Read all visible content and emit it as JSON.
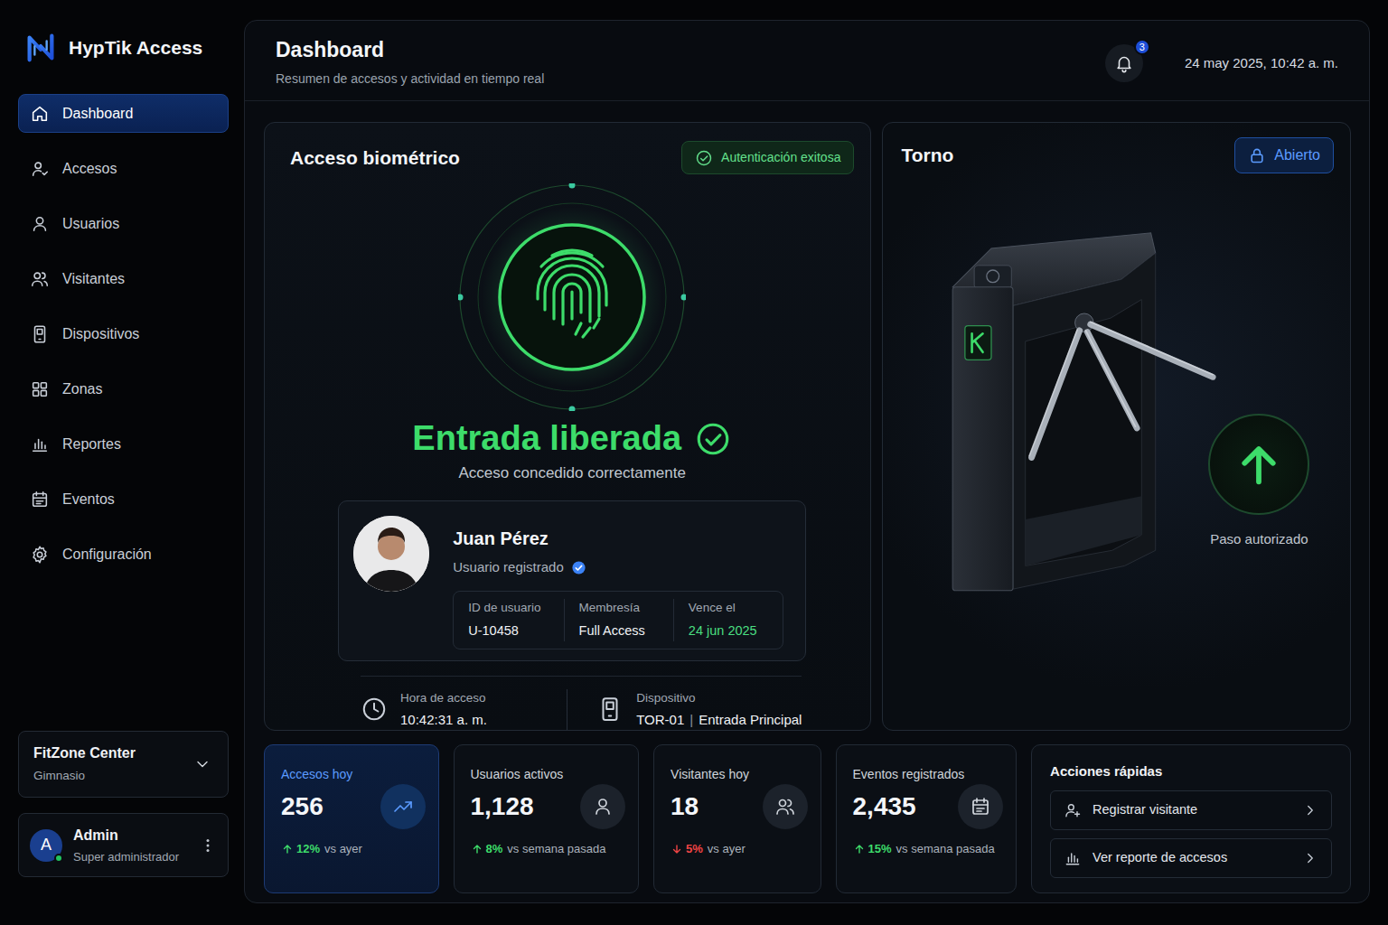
{
  "app": {
    "name": "HypTik Access"
  },
  "sidebar": {
    "items": [
      {
        "label": "Dashboard",
        "selected": true
      },
      {
        "label": "Accesos",
        "selected": false
      },
      {
        "label": "Usuarios",
        "selected": false
      },
      {
        "label": "Visitantes",
        "selected": false
      },
      {
        "label": "Dispositivos",
        "selected": false
      },
      {
        "label": "Zonas",
        "selected": false
      },
      {
        "label": "Reportes",
        "selected": false
      },
      {
        "label": "Eventos",
        "selected": false
      },
      {
        "label": "Configuración",
        "selected": false
      }
    ]
  },
  "org": {
    "name": "FitZone Center",
    "type": "Gimnasio"
  },
  "user": {
    "initial": "A",
    "name": "Admin",
    "role": "Super administrador",
    "online": true
  },
  "header": {
    "title": "Dashboard",
    "subtitle": "Resumen de accesos y actividad en tiempo real",
    "notifications": "3",
    "datetime": "24 may 2025, 10:42 a. m."
  },
  "biometric": {
    "title": "Acceso biométrico",
    "badge": "Autenticación exitosa",
    "status": "Entrada liberada",
    "message": "Acceso concedido correctamente",
    "person": {
      "name": "Juan Pérez",
      "role": "Usuario registrado",
      "verified": true,
      "fields": [
        {
          "label": "ID de usuario",
          "value": "U-10458",
          "highlight": false
        },
        {
          "label": "Membresía",
          "value": "Full Access",
          "highlight": false
        },
        {
          "label": "Vence el",
          "value": "24 jun 2025",
          "highlight": true
        }
      ]
    },
    "access_time": {
      "label": "Hora de acceso",
      "value": "10:42:31 a. m."
    },
    "device": {
      "label": "Dispositivo",
      "id": "TOR-01",
      "separator": "|",
      "location": "Entrada Principal"
    }
  },
  "turnstile": {
    "title": "Torno",
    "state_label": "Abierto",
    "open": true,
    "pass_label": "Paso autorizado"
  },
  "stats": [
    {
      "label": "Accesos hoy",
      "value": "256",
      "change": "12%",
      "trend": "up",
      "compare": "vs ayer",
      "selected": true
    },
    {
      "label": "Usuarios activos",
      "value": "1,128",
      "change": "8%",
      "trend": "up",
      "compare": "vs semana pasada",
      "selected": false
    },
    {
      "label": "Visitantes hoy",
      "value": "18",
      "change": "5%",
      "trend": "down",
      "compare": "vs ayer",
      "selected": false
    },
    {
      "label": "Eventos registrados",
      "value": "2,435",
      "change": "15%",
      "trend": "up",
      "compare": "vs semana pasada",
      "selected": false
    }
  ],
  "quick_actions": {
    "title": "Acciones rápidas",
    "items": [
      {
        "label": "Registrar visitante"
      },
      {
        "label": "Ver reporte de accesos"
      }
    ]
  }
}
